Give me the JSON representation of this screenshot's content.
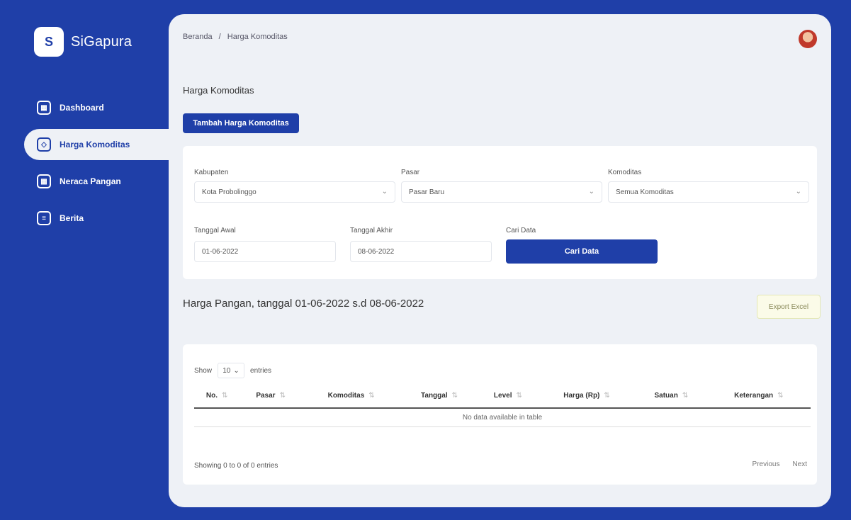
{
  "app": {
    "name": "SiGapura",
    "logo_text": "S"
  },
  "sidebar": {
    "items": [
      {
        "label": "Dashboard",
        "icon": "dashboard-icon",
        "active": false
      },
      {
        "label": "Harga Komoditas",
        "icon": "tag-icon",
        "active": true
      },
      {
        "label": "Neraca Pangan",
        "icon": "balance-icon",
        "active": false
      },
      {
        "label": "Berita",
        "icon": "news-icon",
        "active": false
      }
    ]
  },
  "header": {
    "breadcrumb": [
      "Beranda",
      "Harga Komoditas"
    ],
    "avatar": "user-avatar"
  },
  "page": {
    "title": "Harga Komoditas",
    "add_button": "Tambah Harga Komoditas"
  },
  "filters": {
    "kabupaten": {
      "label": "Kabupaten",
      "value": "Kota Probolinggo"
    },
    "pasar": {
      "label": "Pasar",
      "value": "Pasar Baru"
    },
    "komoditas": {
      "label": "Komoditas",
      "value": "Semua Komoditas"
    },
    "tanggal_awal": {
      "label": "Tanggal Awal",
      "value": "01-06-2022"
    },
    "tanggal_akhir": {
      "label": "Tanggal Akhir",
      "value": "08-06-2022"
    },
    "cari_label": "Cari Data",
    "cari_button": "Cari Data"
  },
  "results": {
    "title": "Harga Pangan, tanggal 01-06-2022 s.d 08-06-2022",
    "export_button": "Export Excel",
    "show_label": "Show",
    "entries_value": "10",
    "entries_label": "entries",
    "columns": [
      "No.",
      "Pasar",
      "Komoditas",
      "Tanggal",
      "Level",
      "Harga (Rp)",
      "Satuan",
      "Keterangan"
    ],
    "empty_message": "No data available in table",
    "info": "Showing 0 to 0 of 0 entries",
    "previous": "Previous",
    "next": "Next"
  }
}
